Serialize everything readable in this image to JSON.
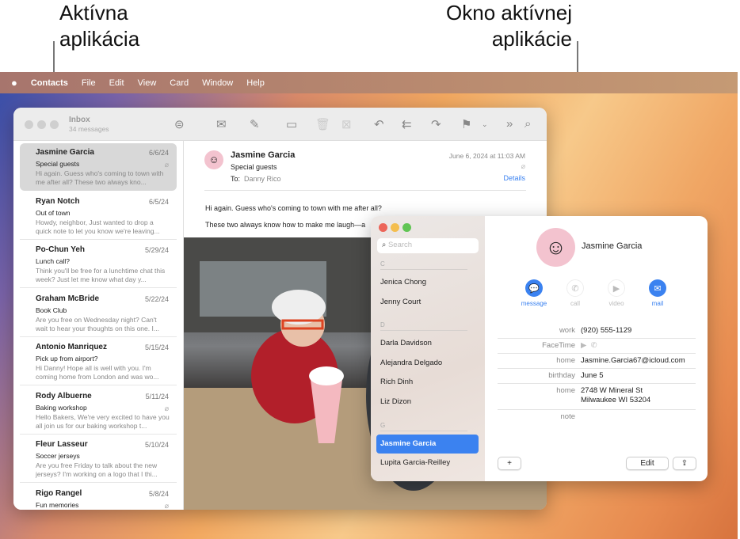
{
  "annotations": {
    "left_line1": "Aktívna",
    "left_line2": "aplikácia",
    "right_line1": "Okno aktívnej",
    "right_line2": "aplikácie"
  },
  "menubar": {
    "apple": "",
    "app": "Contacts",
    "items": [
      "File",
      "Edit",
      "View",
      "Card",
      "Window",
      "Help"
    ]
  },
  "mail": {
    "title": "Inbox",
    "subtitle": "34 messages",
    "messages": [
      {
        "from": "Jasmine Garcia",
        "date": "6/6/24",
        "subject": "Special guests",
        "preview": "Hi again. Guess who's coming to town with me after all? These two always kno...",
        "attachment": true
      },
      {
        "from": "Ryan Notch",
        "date": "6/5/24",
        "subject": "Out of town",
        "preview": "Howdy, neighbor, Just wanted to drop a quick note to let you know we're leaving...",
        "attachment": false
      },
      {
        "from": "Po-Chun Yeh",
        "date": "5/29/24",
        "subject": "Lunch call?",
        "preview": "Think you'll be free for a lunchtime chat this week? Just let me know what day y...",
        "attachment": false
      },
      {
        "from": "Graham McBride",
        "date": "5/22/24",
        "subject": "Book Club",
        "preview": "Are you free on Wednesday night? Can't wait to hear your thoughts on this one. I...",
        "attachment": false
      },
      {
        "from": "Antonio Manriquez",
        "date": "5/15/24",
        "subject": "Pick up from airport?",
        "preview": "Hi Danny! Hope all is well with you. I'm coming home from London and was wo...",
        "attachment": false
      },
      {
        "from": "Rody Albuerne",
        "date": "5/11/24",
        "subject": "Baking workshop",
        "preview": "Hello Bakers, We're very excited to have you all join us for our baking workshop t...",
        "attachment": true
      },
      {
        "from": "Fleur Lasseur",
        "date": "5/10/24",
        "subject": "Soccer jerseys",
        "preview": "Are you free Friday to talk about the new jerseys? I'm working on a logo that I thi...",
        "attachment": false
      },
      {
        "from": "Rigo Rangel",
        "date": "5/8/24",
        "subject": "Fun memories",
        "preview": "",
        "attachment": true
      }
    ],
    "open": {
      "from": "Jasmine Garcia",
      "subject": "Special guests",
      "to_label": "To:",
      "to": "Danny Rico",
      "date": "June 6, 2024 at 11:03 AM",
      "details": "Details",
      "body1": "Hi again. Guess who's coming to town with me after all?",
      "body2": "These two always know how to make me laugh—a"
    }
  },
  "contacts": {
    "search_placeholder": "Search",
    "sections": [
      {
        "letter": "C",
        "names": [
          "Jenica Chong",
          "Jenny Court"
        ]
      },
      {
        "letter": "D",
        "names": [
          "Darla Davidson",
          "Alejandra Delgado",
          "Rich Dinh",
          "Liz Dizon"
        ]
      },
      {
        "letter": "G",
        "names": [
          "Jasmine Garcia",
          "Lupita Garcia-Reilley"
        ]
      }
    ],
    "selected": "Jasmine Garcia",
    "card": {
      "name": "Jasmine Garcia",
      "actions": [
        {
          "label": "message",
          "enabled": true
        },
        {
          "label": "call",
          "enabled": false
        },
        {
          "label": "video",
          "enabled": false
        },
        {
          "label": "mail",
          "enabled": true
        }
      ],
      "fields": [
        {
          "label": "work",
          "value": "(920) 555-1129"
        },
        {
          "label": "FaceTime",
          "value": ""
        },
        {
          "label": "home",
          "value": "Jasmine.Garcia67@icloud.com"
        },
        {
          "label": "birthday",
          "value": "June 5"
        },
        {
          "label": "home",
          "value": "2748 W Mineral St",
          "value2": "Milwaukee WI 53204"
        },
        {
          "label": "note",
          "value": ""
        }
      ],
      "add": "+",
      "edit": "Edit"
    },
    "accent": "#3b82f0"
  }
}
